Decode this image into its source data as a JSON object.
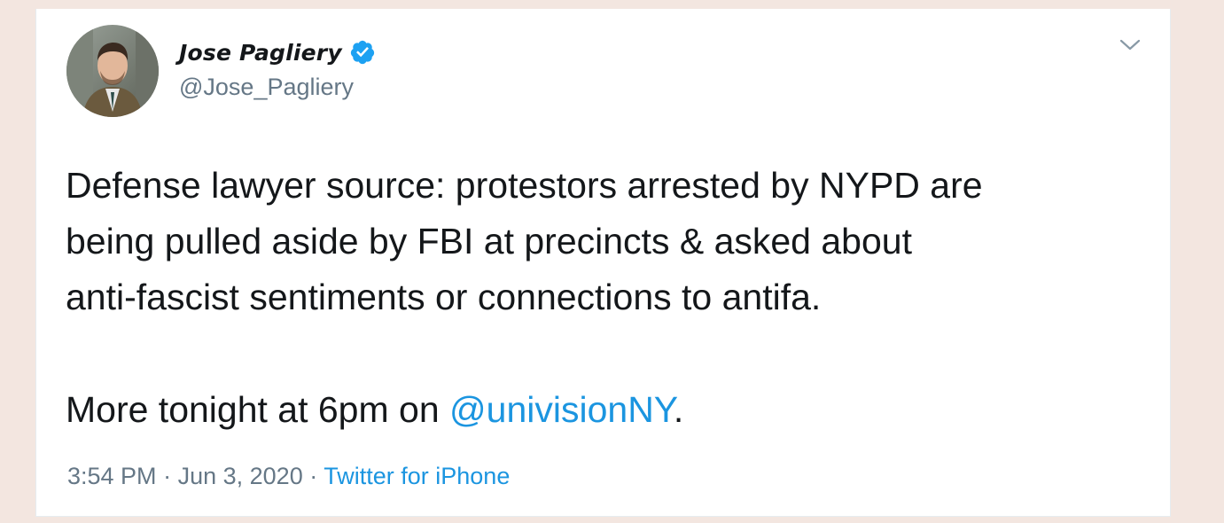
{
  "tweet": {
    "author": {
      "name": "Jose Pagliery",
      "handle": "@Jose_Pagliery",
      "verified_icon": "verified-badge-icon"
    },
    "menu_icon": "chevron-down-icon",
    "text": {
      "line1": "Defense lawyer source: protestors arrested by NYPD are",
      "line2": "being pulled aside by FBI at precincts & asked about",
      "line3": "anti-fascist sentiments or connections to antifa.",
      "line4_prefix": "More tonight at 6pm on ",
      "mention": "@univisionNY",
      "line4_suffix": "."
    },
    "time": "3:54 PM",
    "separator": "·",
    "date": "Jun 3, 2020",
    "source": "Twitter for iPhone"
  },
  "colors": {
    "page_background": "#f3e6e0",
    "card_background": "#ffffff",
    "text": "#14171a",
    "secondary_text": "#657786",
    "link": "#1b95e0",
    "verified": "#1da1f2"
  }
}
